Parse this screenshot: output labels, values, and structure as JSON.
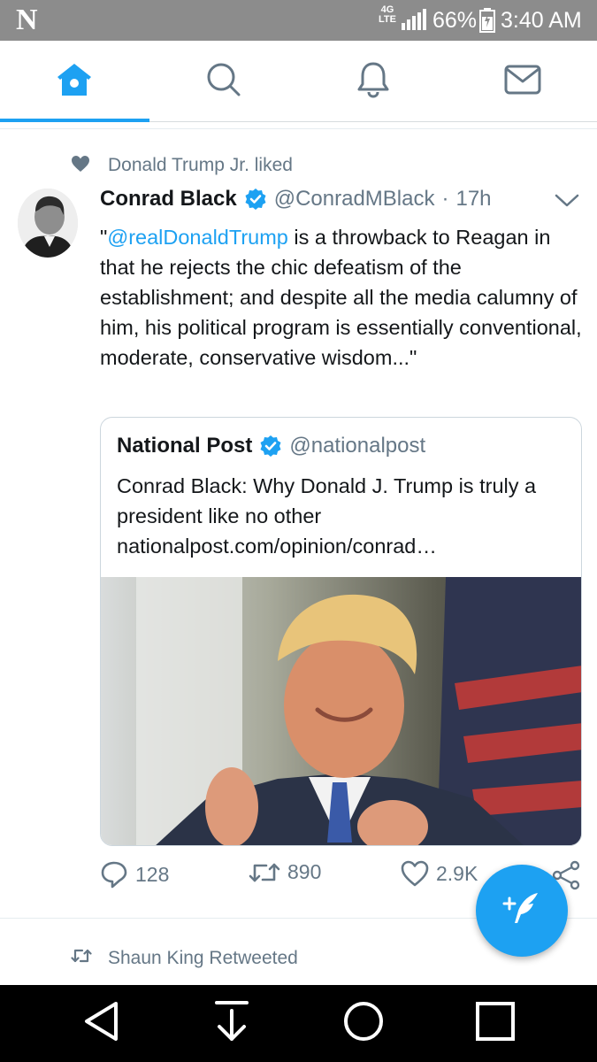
{
  "status_bar": {
    "carrier_logo": "N",
    "network_top": "4G",
    "network_bottom": "LTE",
    "battery": "66%",
    "time": "3:40 AM"
  },
  "tabs": [
    {
      "name": "home",
      "icon": "home-icon",
      "active": true
    },
    {
      "name": "search",
      "icon": "search-icon",
      "active": false
    },
    {
      "name": "notifications",
      "icon": "bell-icon",
      "active": false
    },
    {
      "name": "messages",
      "icon": "mail-icon",
      "active": false
    }
  ],
  "tweet": {
    "social_context": "Donald Trump Jr. liked",
    "display_name": "Conrad Black",
    "handle": "@ConradMBlack",
    "separator": "·",
    "time": "17h",
    "text_open_quote": "\"",
    "text_mention": "@realDonaldTrump",
    "text_body": " is a throwback to Reagan in that he rejects the chic defeatism of the establishment; and despite all the media calumny of him, his political program is essentially conventional, moderate, conservative wisdom...\"",
    "quoted": {
      "display_name": "National Post",
      "handle": "@nationalpost",
      "text_line1": "Conrad Black: Why Donald J. Trump is truly a president like no other",
      "text_link": "nationalpost.com/opinion/conrad…"
    },
    "actions": {
      "replies": "128",
      "retweets": "890",
      "likes": "2.9K"
    }
  },
  "next_tweet": {
    "social_context": "Shaun King Retweeted"
  },
  "colors": {
    "accent": "#1da1f2",
    "secondary_text": "#657786",
    "status_bar": "#8c8c8c",
    "nav_bar": "#000000"
  }
}
